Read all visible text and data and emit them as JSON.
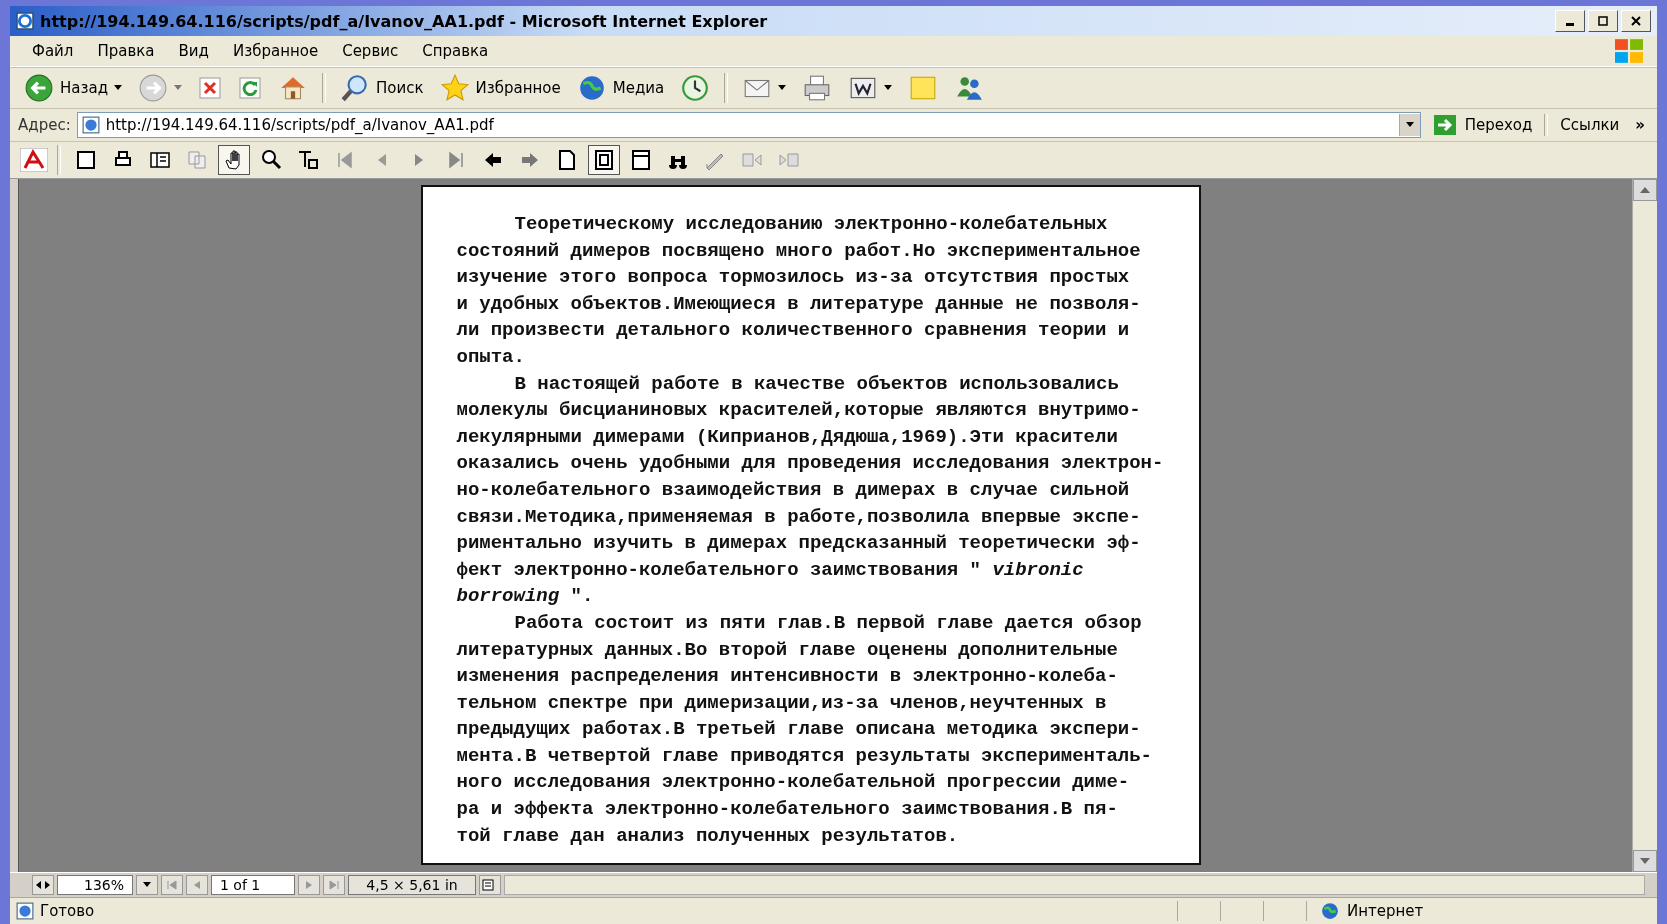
{
  "window": {
    "title": "http://194.149.64.116/scripts/pdf_a/Ivanov_AA1.pdf - Microsoft Internet Explorer"
  },
  "menu": [
    "Файл",
    "Правка",
    "Вид",
    "Избранное",
    "Сервис",
    "Справка"
  ],
  "toolbar": {
    "back": "Назад",
    "search": "Поиск",
    "favorites": "Избранное",
    "media": "Медиа"
  },
  "address_bar": {
    "label": "Адрес:",
    "url": "http://194.149.64.116/scripts/pdf_a/Ivanov_AA1.pdf",
    "go": "Переход",
    "links": "Ссылки",
    "more": "»"
  },
  "document": {
    "paragraphs": [
      {
        "lines": [
          "Теоретическому исследованию электронно-колебательных",
          "состояний димеров посвящено много работ.Но экспериментальное",
          "изучение этого вопроса тормозилось из-за отсутствия простых",
          "и удобных объектов.Имеющиеся в литературе данные не позволя-",
          "ли произвести детального количественного сравнения теории и",
          "опыта."
        ]
      },
      {
        "lines": [
          "В настоящей работе в качестве объектов использовались",
          "молекулы бисцианиновых красителей,которые являются внутримо-",
          "лекулярными димерами (Киприанов,Дядюша,1969).Эти красители",
          "оказались очень удобными для проведения исследования электрон-",
          "но-колебательного взаимодействия в димерах в случае сильной",
          "связи.Методика,применяемая в работе,позволила впервые экспе-",
          "риментально изучить в димерах предсказанный теоретически эф-",
          "фект электронно-колебательного заимствования \" *vibronic*",
          "*borrowing* \"."
        ]
      },
      {
        "lines": [
          "Работа состоит из пяти глав.В первой главе дается обзор",
          "литературных данных.Во второй главе оценены дополнительные",
          "изменения распределения интенсивности в электронно-колеба-",
          "тельном спектре при димеризации,из-за членов,неучтенных в",
          "предыдущих работах.В третьей главе описана методика экспери-",
          "мента.В четвертой главе приводятся результаты эксперименталь-",
          "ного исследования электронно-колебательной прогрессии диме-",
          "ра и эффекта электронно-колебательного заимствования.В пя-",
          "той главе дан анализ полученных результатов."
        ]
      }
    ]
  },
  "pdf_status": {
    "zoom": "136%",
    "page": "1 of 1",
    "size": "4,5 × 5,61 in"
  },
  "status_bar": {
    "text": "Готово",
    "zone": "Интернет"
  }
}
